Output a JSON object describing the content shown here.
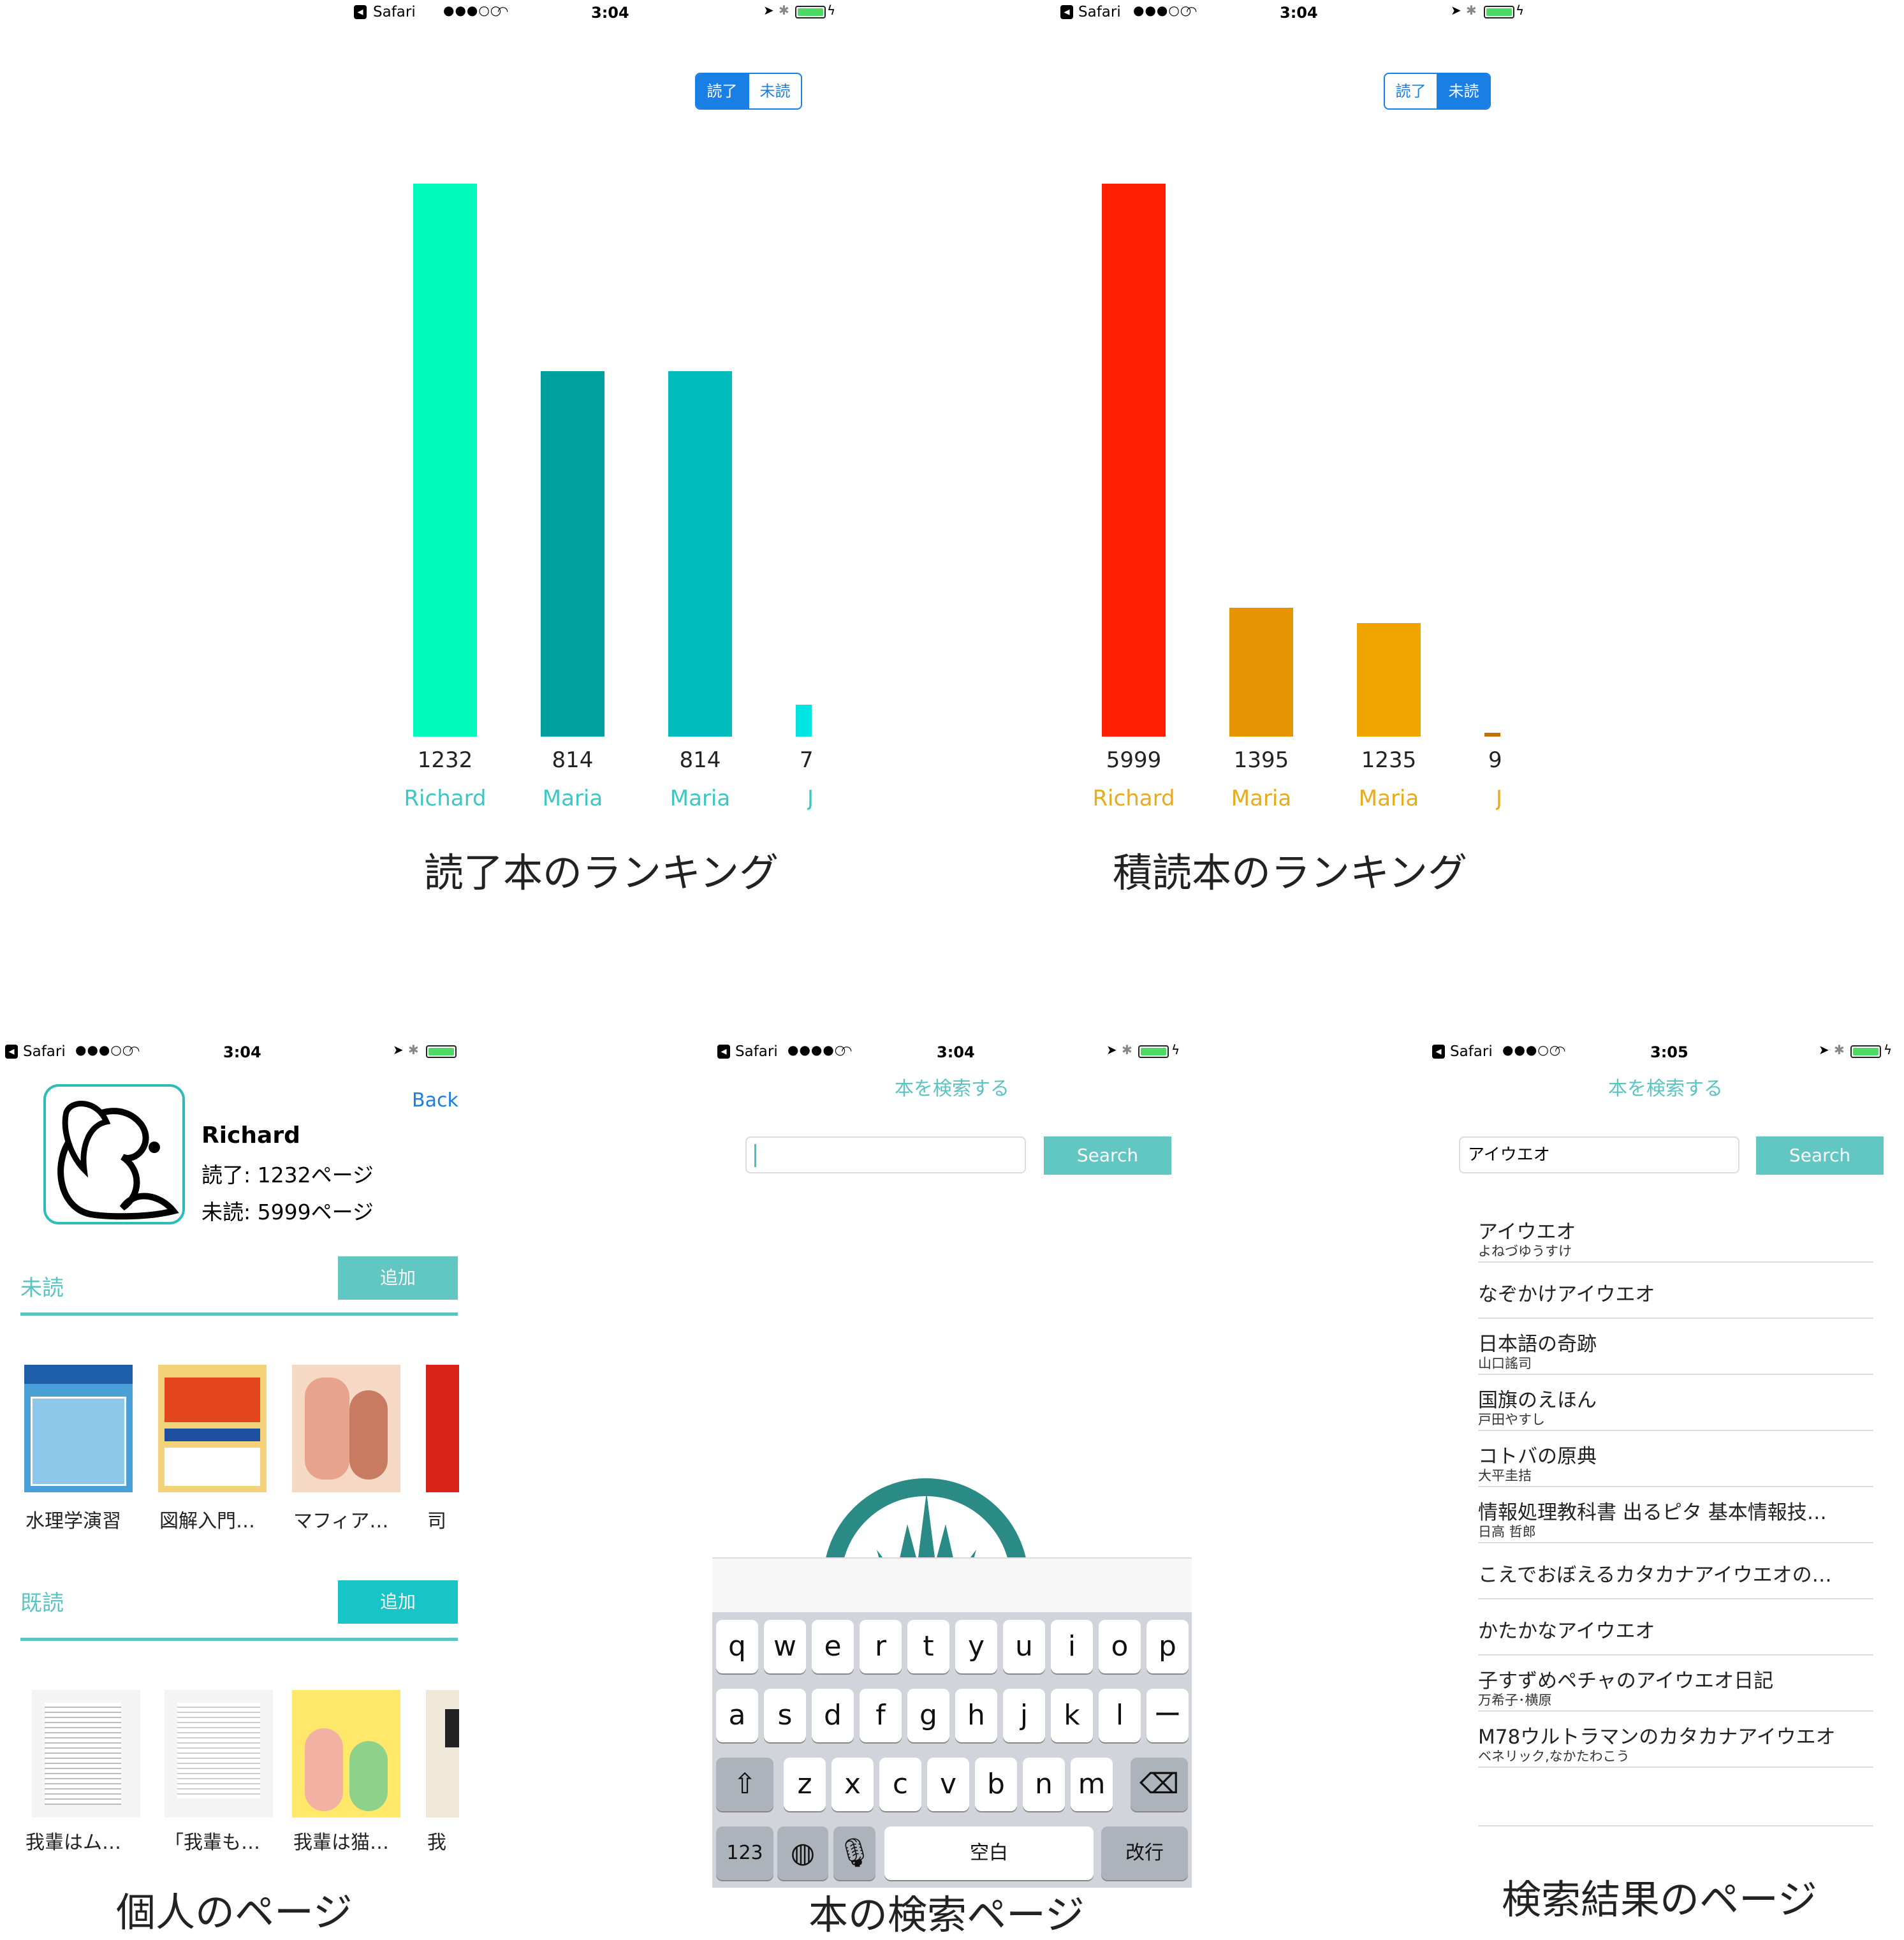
{
  "status": {
    "app": "Safari",
    "time_a": "3:04",
    "time_b": "3:05"
  },
  "segment": {
    "read": "読了",
    "unread": "未読"
  },
  "chart_read": {
    "caption": "読了本のランキング",
    "chart_data": {
      "type": "bar",
      "categories": [
        "Richard",
        "Maria",
        "Maria",
        "J"
      ],
      "values": [
        1232,
        814,
        814,
        71
      ],
      "value_labels": [
        "1232",
        "814",
        "814",
        "7"
      ],
      "name_labels": [
        "Richard",
        "Maria",
        "Maria",
        "J"
      ],
      "colors": [
        "#00f9bd",
        "#00a19f",
        "#00bcbc",
        "#00e4e2"
      ],
      "label_color": "#3cc7c2",
      "ylim": [
        0,
        1232
      ]
    }
  },
  "chart_unread": {
    "caption": "積読本のランキング",
    "chart_data": {
      "type": "bar",
      "categories": [
        "Richard",
        "Maria",
        "Maria",
        "J"
      ],
      "values": [
        5999,
        1395,
        1235,
        9
      ],
      "value_labels": [
        "5999",
        "1395",
        "1235",
        "9"
      ],
      "name_labels": [
        "Richard",
        "Maria",
        "Maria",
        "J"
      ],
      "colors": [
        "#ff1f01",
        "#e59502",
        "#f0a400",
        "#c07205"
      ],
      "label_color": "#e9aa1b",
      "ylim": [
        0,
        5999
      ]
    }
  },
  "profile": {
    "back": "Back",
    "name": "Richard",
    "read": "読了: 1232ページ",
    "unread": "未読: 5999ページ",
    "section_unread": "未読",
    "section_read": "既読",
    "add": "追加",
    "unread_books": [
      "水理学演習",
      "図解入門…",
      "マフィア…",
      "司"
    ],
    "read_books": [
      "我輩はム…",
      "「我輩も…",
      "我輩は猫…",
      "我"
    ],
    "caption": "個人のページ"
  },
  "search": {
    "title": "本を検索する",
    "button": "Search",
    "input_value": "",
    "caption": "本の検索ページ",
    "keyboard": {
      "row1": [
        "q",
        "w",
        "e",
        "r",
        "t",
        "y",
        "u",
        "i",
        "o",
        "p"
      ],
      "row2": [
        "a",
        "s",
        "d",
        "f",
        "g",
        "h",
        "j",
        "k",
        "l",
        "ー"
      ],
      "row3": [
        "z",
        "x",
        "c",
        "v",
        "b",
        "n",
        "m"
      ],
      "num": "123",
      "space": "空白",
      "return": "改行"
    }
  },
  "results": {
    "title": "本を検索する",
    "query": "アイウエオ",
    "button": "Search",
    "caption": "検索結果のページ",
    "items": [
      {
        "title": "アイウエオ",
        "author": "よねづゆうすけ"
      },
      {
        "title": "なぞかけアイウエオ",
        "author": ""
      },
      {
        "title": "日本語の奇跡",
        "author": "山口謠司"
      },
      {
        "title": "国旗のえほん",
        "author": "戸田やすし"
      },
      {
        "title": "コトバの原典",
        "author": "大平圭拮"
      },
      {
        "title": "情報処理教科書 出るピタ 基本情報技…",
        "author": "日高 哲郎"
      },
      {
        "title": "こえでおぼえるカタカナアイウエオの…",
        "author": ""
      },
      {
        "title": "かたかなアイウエオ",
        "author": ""
      },
      {
        "title": "子すずめペチャのアイウエオ日記",
        "author": "万希子･横原"
      },
      {
        "title": "M78ウルトラマンのカタカナアイウエオ",
        "author": "ベネリック,なかたわこう"
      }
    ]
  }
}
